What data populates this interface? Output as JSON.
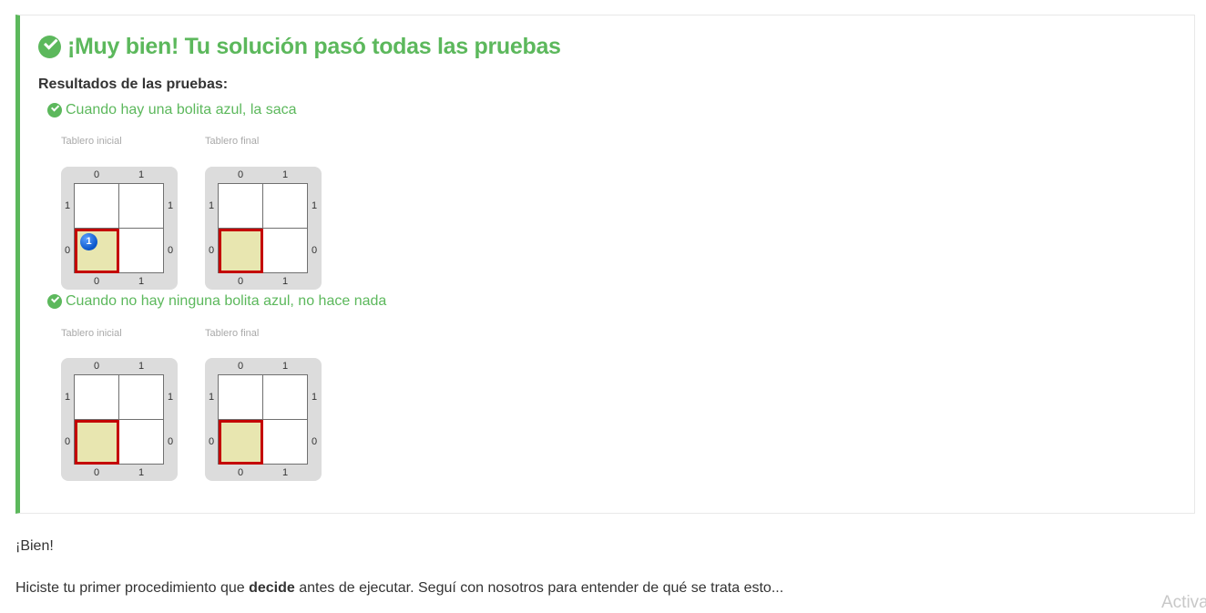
{
  "result": {
    "headline": "¡Muy bien! Tu solución pasó todas las pruebas",
    "results_label": "Resultados de las pruebas:",
    "status_color": "#5cb85c",
    "tests": [
      {
        "title": "Cuando hay una bolita azul, la saca",
        "initial_label": "Tablero inicial",
        "final_label": "Tablero final",
        "initial_board": {
          "cols": [
            "0",
            "1"
          ],
          "rows": [
            "1",
            "0"
          ],
          "head": [
            0,
            0
          ],
          "blue_balls": "1"
        },
        "final_board": {
          "cols": [
            "0",
            "1"
          ],
          "rows": [
            "1",
            "0"
          ],
          "head": [
            0,
            0
          ],
          "blue_balls": ""
        }
      },
      {
        "title": "Cuando no hay ninguna bolita azul, no hace nada",
        "initial_label": "Tablero inicial",
        "final_label": "Tablero final",
        "initial_board": {
          "cols": [
            "0",
            "1"
          ],
          "rows": [
            "1",
            "0"
          ],
          "head": [
            0,
            0
          ],
          "blue_balls": ""
        },
        "final_board": {
          "cols": [
            "0",
            "1"
          ],
          "rows": [
            "1",
            "0"
          ],
          "head": [
            0,
            0
          ],
          "blue_balls": ""
        }
      }
    ]
  },
  "message": {
    "line1": "¡Bien!",
    "line2_before": "Hiciste tu primer procedimiento que ",
    "line2_bold": "decide",
    "line2_after": " antes de ejecutar. Seguí con nosotros para entender de qué se trata esto..."
  },
  "watermark": "Activa",
  "icons": {
    "headline": "check-circle-icon",
    "test": "check-circle-icon",
    "ball": "blue-ball-icon"
  }
}
